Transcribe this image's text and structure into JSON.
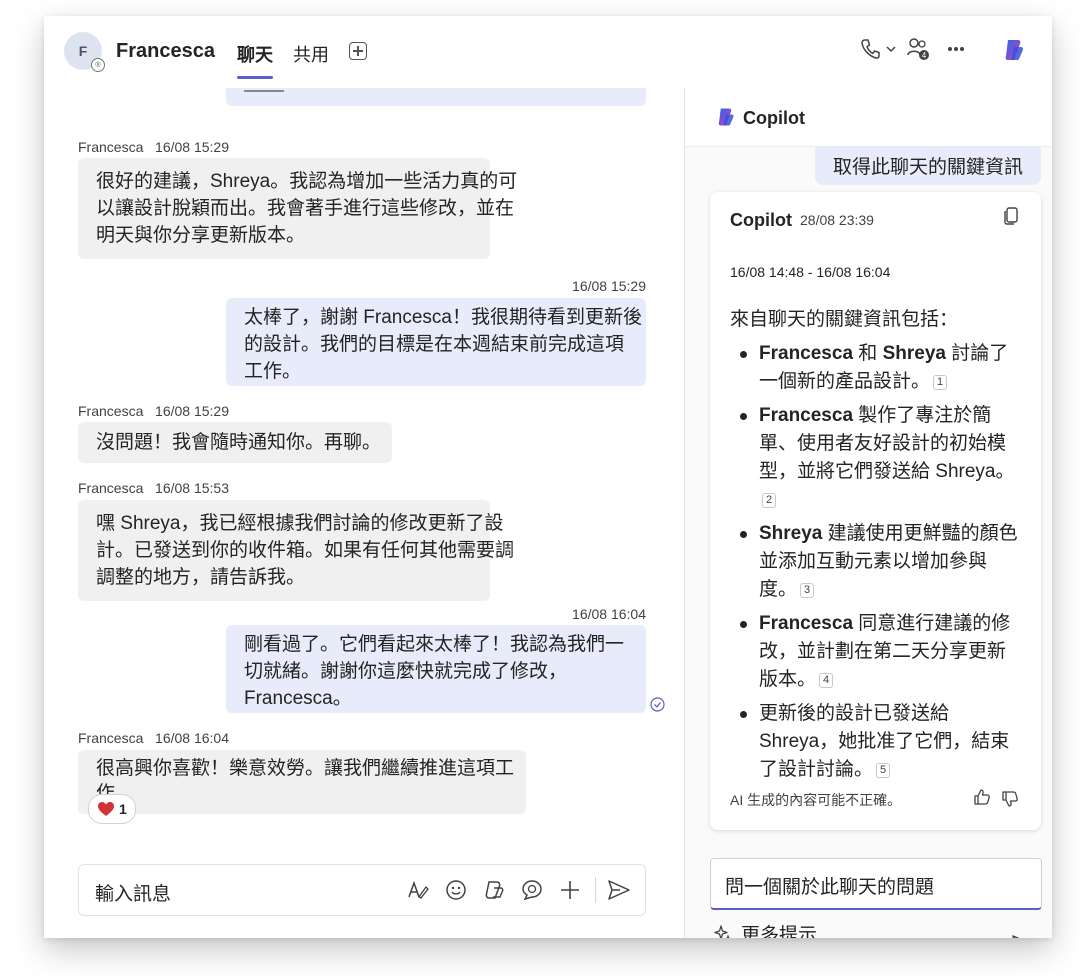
{
  "header": {
    "avatar_initial": "F",
    "avatar_badge": "®",
    "chat_name": "Francesca",
    "tabs": [
      {
        "label": "聊天"
      },
      {
        "label": "共用"
      }
    ],
    "icons": [
      "call-icon",
      "chevron-down-icon",
      "participants-icon",
      "more-icon",
      "copilot-icon"
    ],
    "participants_count": "4"
  },
  "messages": [
    {
      "direction": "in",
      "author": "Francesca",
      "time": "16/08 15:29",
      "lines": [
        "很好的建議，Shreya。我認為增加一些活力真的可",
        "以讓設計脫穎而出。我會著手進行這些修改，並在",
        "明天與你分享更新版本。"
      ]
    },
    {
      "direction": "out",
      "time": "16/08 15:29",
      "lines": [
        "太棒了，謝謝 Francesca！我很期待看到更新後",
        "的設計。我們的目標是在本週結束前完成這項",
        "工作。"
      ]
    },
    {
      "direction": "in",
      "author": "Francesca",
      "time": "16/08 15:29",
      "lines": [
        "沒問題！我會隨時通知你。再聊。"
      ]
    },
    {
      "direction": "in",
      "author": "Francesca",
      "time": "16/08 15:53",
      "lines": [
        "嘿 Shreya，我已經根據我們討論的修改更新了設",
        "計。已發送到你的收件箱。如果有任何其他需要調",
        "調整的地方，請告訴我。"
      ]
    },
    {
      "direction": "out",
      "time": "16/08 16:04",
      "lines": [
        "剛看過了。它們看起來太棒了！我認為我們一",
        "切就緒。謝謝你這麼快就完成了修改，",
        "Francesca。"
      ]
    },
    {
      "direction": "in",
      "author": "Francesca",
      "time": "16/08 16:04",
      "lines": [
        "很高興你喜歡！樂意效勞。讓我們繼續推進這項工",
        "作。"
      ],
      "reaction": {
        "icon": "heart-icon",
        "count": "1"
      }
    }
  ],
  "compose": {
    "placeholder": "輸入訊息",
    "icons": [
      "format-icon",
      "emoji-icon",
      "loop-icon",
      "praise-icon",
      "add-icon",
      "send-icon"
    ]
  },
  "copilot": {
    "title": "Copilot",
    "user_prompt": "取得此聊天的關鍵資訊",
    "response": {
      "author": "Copilot",
      "time": "28/08 23:39",
      "range": "16/08 14:48 - 16/08 16:04",
      "intro": "來自聊天的關鍵資訊包括：",
      "bullets": [
        {
          "lines": [
            [
              "b",
              "Francesca"
            ],
            [
              "t",
              " 和 "
            ],
            [
              "b",
              "Shreya"
            ],
            [
              "t",
              " 討論了一個新的產品設計。"
            ]
          ],
          "ref": "1"
        },
        {
          "lines": [
            [
              "b",
              "Francesca"
            ],
            [
              "t",
              " 製作了專注於簡單、使用者友好設計的初始模型，並將它們發送給 Shreya。"
            ]
          ],
          "ref": "2"
        },
        {
          "lines": [
            [
              "b",
              "Shreya"
            ],
            [
              "t",
              " 建議使用更鮮豔的顏色並添加互動元素以增加參與度。"
            ]
          ],
          "ref": "3"
        },
        {
          "lines": [
            [
              "b",
              "Francesca"
            ],
            [
              "t",
              " 同意進行建議的修改，並計劃在第二天分享更新版本。"
            ]
          ],
          "ref": "4"
        },
        {
          "lines": [
            [
              "t",
              "更新後的設計已發送給 Shreya，她批准了它們，結束了設計討論。"
            ]
          ],
          "ref": "5"
        }
      ],
      "disclaimer": "AI 生成的內容可能不正確。"
    },
    "question_input": "問一個關於此聊天的問題",
    "more_prompts": "更多提示"
  },
  "colors": {
    "accent": "#5b5fc7",
    "self_bubble": "#e8ebfa",
    "other_bubble": "#f0f0f0",
    "heart": "#d13438"
  }
}
